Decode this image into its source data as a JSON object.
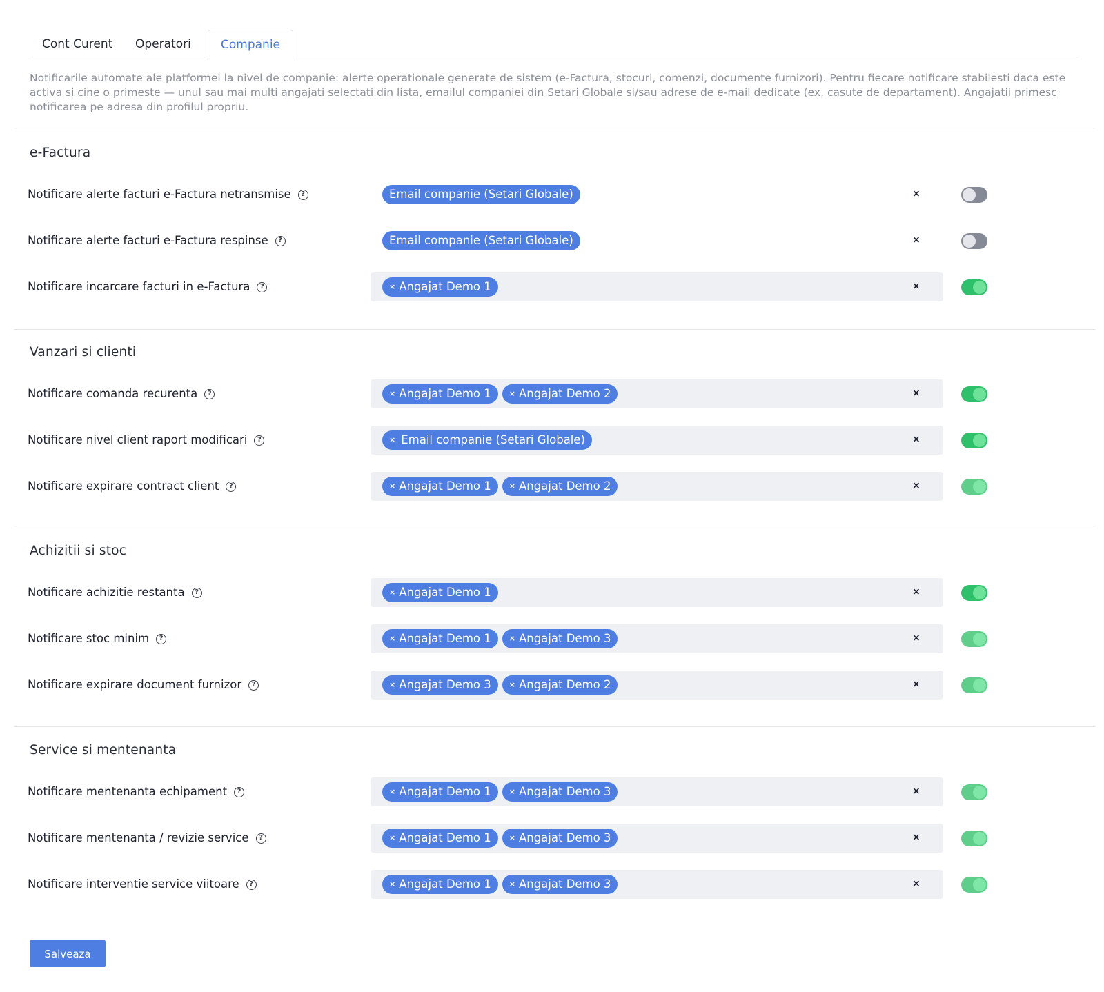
{
  "tabs": [
    {
      "label": "Cont Curent",
      "active": false
    },
    {
      "label": "Operatori",
      "active": false
    },
    {
      "label": "Companie",
      "active": true
    }
  ],
  "intro": "Notificarile automate ale platformei la nivel de companie: alerte operationale generate de sistem (e-Factura, stocuri, comenzi, documente furnizori). Pentru fiecare notificare stabilesti daca este activa si cine o primeste — unul sau mai multi angajati selectati din lista, emailul companiei din Setari Globale si/sau adrese de e-mail dedicate (ex. casute de departament). Angajatii primesc notificarea pe adresa din profilul propriu.",
  "sections": [
    {
      "title": "e-Factura",
      "rows": [
        {
          "label": "Notificare alerte facturi e-Factura netransmise",
          "tags": [
            "Email companie (Setari Globale)"
          ],
          "removable": false,
          "enabled": false
        },
        {
          "label": "Notificare alerte facturi e-Factura respinse",
          "tags": [
            "Email companie (Setari Globale)"
          ],
          "removable": false,
          "enabled": false
        },
        {
          "label": "Notificare incarcare facturi in e-Factura",
          "tags": [
            "Angajat Demo 1"
          ],
          "removable": true,
          "enabled": true
        }
      ]
    },
    {
      "title": "Vanzari si clienti",
      "rows": [
        {
          "label": "Notificare comanda recurenta",
          "tags": [
            "Angajat Demo 1",
            "Angajat Demo 2"
          ],
          "removable": true,
          "enabled": true
        },
        {
          "label": "Notificare nivel client raport modificari",
          "tags": [
            "Email companie (Setari Globale)"
          ],
          "removable": true,
          "enabled": true
        },
        {
          "label": "Notificare expirare contract client",
          "tags": [
            "Angajat Demo 1",
            "Angajat Demo 2"
          ],
          "removable": true,
          "enabled": true
        }
      ]
    },
    {
      "title": "Achizitii si stoc",
      "rows": [
        {
          "label": "Notificare achizitie restanta",
          "tags": [
            "Angajat Demo 1"
          ],
          "removable": true,
          "enabled": true
        },
        {
          "label": "Notificare stoc minim",
          "tags": [
            "Angajat Demo 1",
            "Angajat Demo 3"
          ],
          "removable": true,
          "enabled": true
        },
        {
          "label": "Notificare expirare document furnizor",
          "tags": [
            "Angajat Demo 3",
            "Angajat Demo 2"
          ],
          "removable": true,
          "enabled": true
        }
      ]
    },
    {
      "title": "Service si mentenanta",
      "rows": [
        {
          "label": "Notificare mentenanta echipament",
          "tags": [
            "Angajat Demo 1",
            "Angajat Demo 3"
          ],
          "removable": true,
          "enabled": true
        },
        {
          "label": "Notificare mentenanta / revizie service",
          "tags": [
            "Angajat Demo 1",
            "Angajat Demo 3"
          ],
          "removable": true,
          "enabled": true
        },
        {
          "label": "Notificare interventie service viitoare",
          "tags": [
            "Angajat Demo 1",
            "Angajat Demo 3"
          ],
          "removable": true,
          "enabled": true
        }
      ]
    }
  ],
  "icons": {
    "help": "question-circle-icon",
    "clear": "close-icon",
    "tag_remove": "close-icon"
  },
  "glyphs": {
    "help": "?",
    "clear": "×",
    "tag_remove": "×"
  },
  "save_label": "Salveaza",
  "colors": {
    "accent": "#4f7ee3",
    "toggle_on": "#2ec06a",
    "toggle_off": "#868a96",
    "active_tab": "#4a78d6"
  }
}
